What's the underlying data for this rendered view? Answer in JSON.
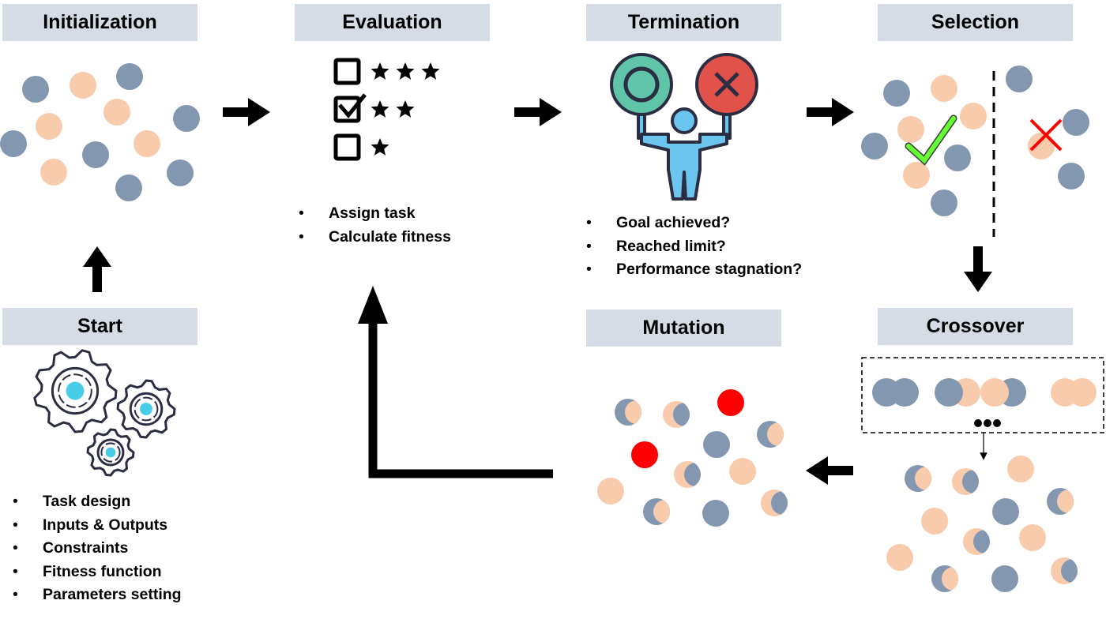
{
  "colors": {
    "blue": "#8497b0",
    "peach": "#f8cbad",
    "mutant": "#ff0000",
    "header_bg": "#d6dce5",
    "arrow": "#000000"
  },
  "stages": {
    "initialization": {
      "title": "Initialization"
    },
    "evaluation": {
      "title": "Evaluation",
      "bullets": [
        "Assign task",
        "Calculate fitness"
      ]
    },
    "termination": {
      "title": "Termination",
      "bullets": [
        "Goal achieved?",
        "Reached limit?",
        "Performance stagnation?"
      ]
    },
    "selection": {
      "title": "Selection"
    },
    "start": {
      "title": "Start",
      "bullets": [
        "Task design",
        "Inputs & Outputs",
        "Constraints",
        "Fitness function",
        "Parameters setting"
      ]
    },
    "mutation": {
      "title": "Mutation"
    },
    "crossover": {
      "title": "Crossover"
    }
  },
  "icons": {
    "evaluation": [
      "checkbox-icon",
      "star-icon",
      "checked-checkbox-icon"
    ],
    "termination": [
      "person-holding-signs-icon",
      "circle-sign-icon",
      "x-sign-icon"
    ],
    "selection": [
      "checkmark-icon",
      "cross-icon"
    ],
    "start": [
      "gears-icon"
    ],
    "crossover": [
      "ellipsis-icon"
    ]
  }
}
